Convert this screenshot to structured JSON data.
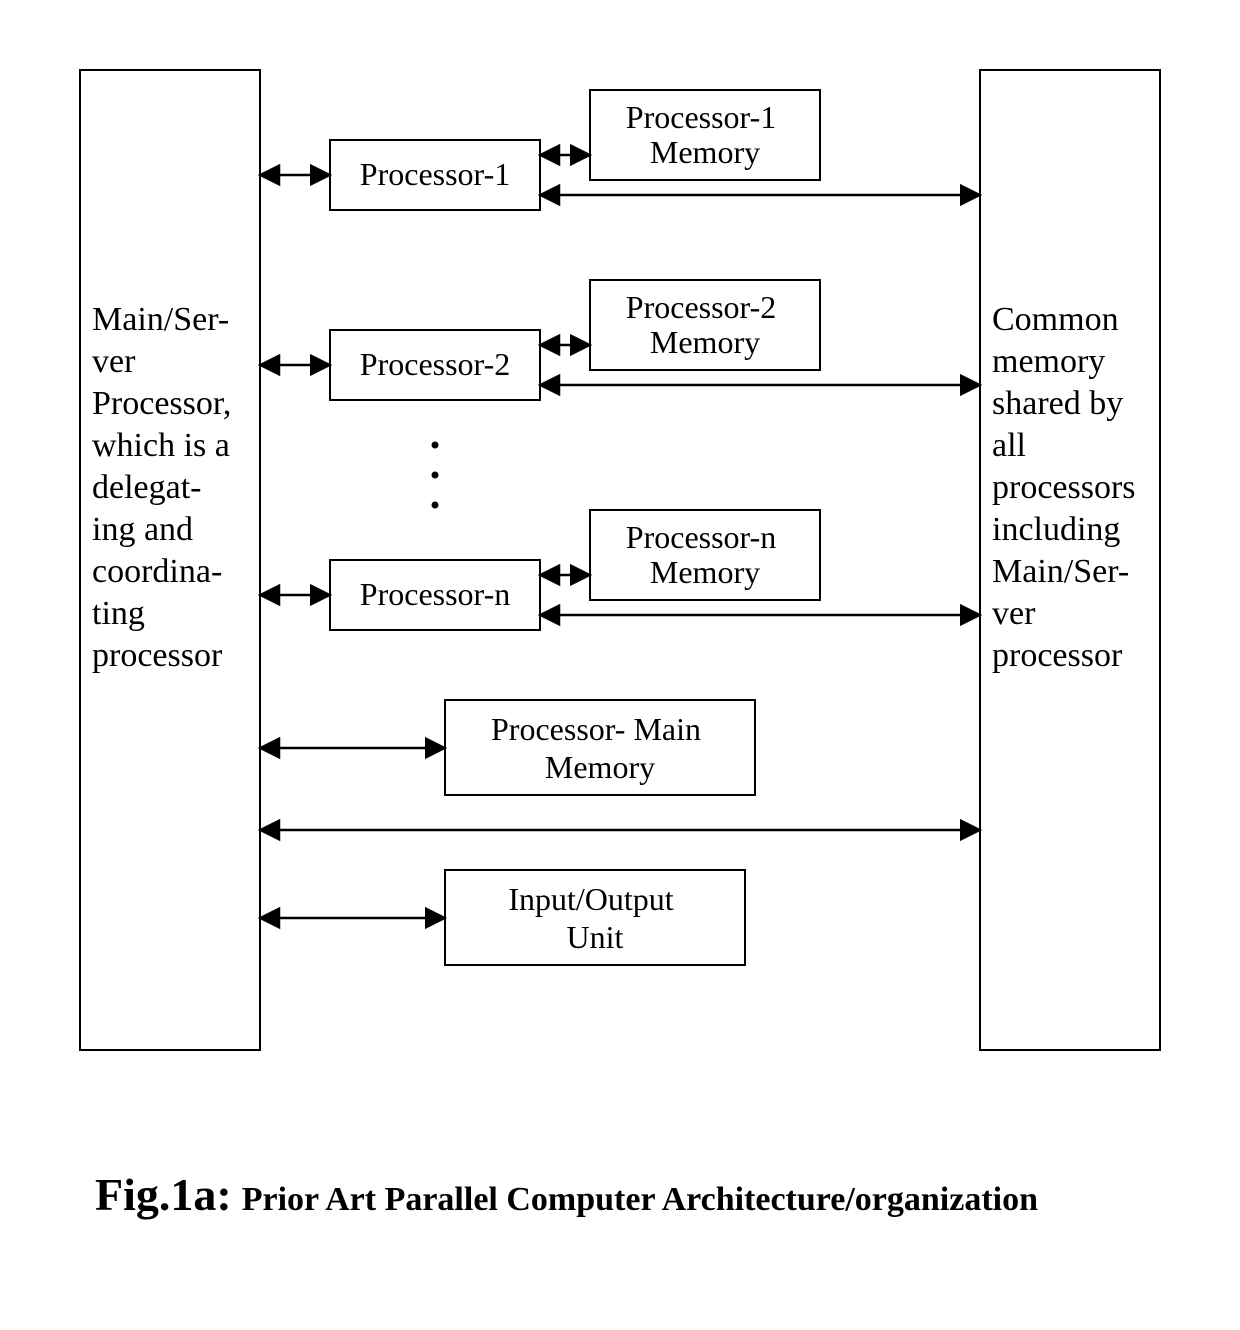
{
  "main_block": {
    "line1": "Main/Ser-",
    "line2": "ver",
    "line3": "Processor,",
    "line4": "which is a",
    "line5": "delegat-",
    "line6": "ing and",
    "line7": "coordina-",
    "line8": "ting",
    "line9": "processor"
  },
  "common_block": {
    "line1": "Common",
    "line2": "memory",
    "line3": "shared by",
    "line4": "all",
    "line5": "processors",
    "line6": "including",
    "line7": "Main/Ser-",
    "line8": "ver",
    "line9": "processor"
  },
  "proc1": {
    "label": "Processor-1",
    "mem1": "Processor-1",
    "mem2": "Memory"
  },
  "proc2": {
    "label": "Processor-2",
    "mem1": "Processor-2",
    "mem2": "Memory"
  },
  "procn": {
    "label": "Processor-n",
    "mem1": "Processor-n",
    "mem2": "Memory"
  },
  "main_mem": {
    "line1": "Processor- Main",
    "line2": "Memory"
  },
  "io_unit": {
    "line1": "Input/Output",
    "line2": "Unit"
  },
  "ellipsis": "⋮",
  "caption": {
    "fig": "Fig.1a:",
    "title": "Prior Art Parallel Computer Architecture/organization"
  }
}
